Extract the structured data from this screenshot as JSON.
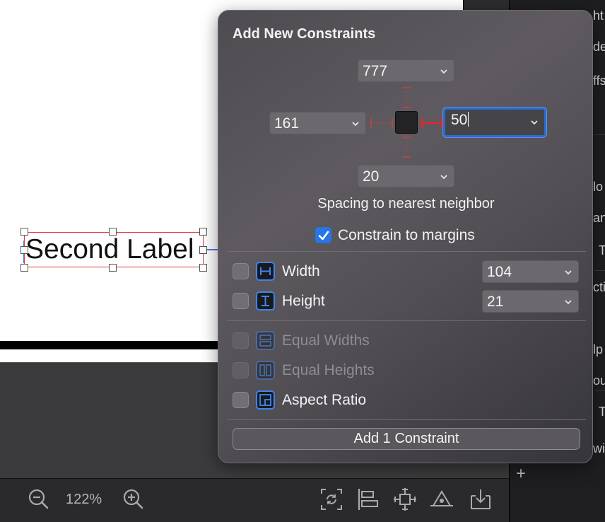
{
  "canvas": {
    "label_text": "Second Label",
    "zoom": "122%"
  },
  "inspector": {
    "fragments": [
      "ht",
      "de",
      "ffs",
      "lo",
      "an",
      "T",
      "cti",
      "lp",
      "ou",
      "T",
      "wi"
    ]
  },
  "popover": {
    "title": "Add New Constraints",
    "top_value": "777",
    "left_value": "161",
    "right_value": "50",
    "bottom_value": "20",
    "spacing_label": "Spacing to nearest neighbor",
    "constrain_margins_label": "Constrain to margins",
    "constrain_margins_checked": true,
    "width": {
      "label": "Width",
      "value": "104",
      "checked": false
    },
    "height": {
      "label": "Height",
      "value": "21",
      "checked": false
    },
    "equal_widths": {
      "label": "Equal Widths",
      "enabled": false
    },
    "equal_heights": {
      "label": "Equal Heights",
      "enabled": false
    },
    "aspect_ratio": {
      "label": "Aspect Ratio",
      "checked": false
    },
    "add_button_label": "Add 1 Constraint"
  },
  "colors": {
    "accent_blue": "#2775e6",
    "constraint_red": "#e02a2a"
  },
  "icons": [
    "zoom-out-icon",
    "zoom-in-icon",
    "update-frames-icon",
    "align-icon",
    "add-constraints-icon",
    "resolve-issues-icon",
    "embed-in-icon",
    "chevron-down-icon",
    "checkmark-icon",
    "plus-icon"
  ]
}
